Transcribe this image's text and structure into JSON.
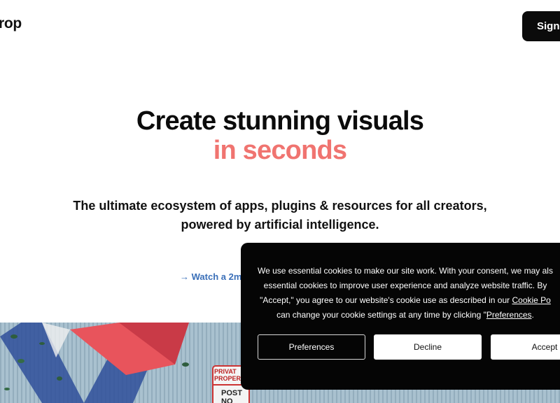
{
  "header": {
    "logo_text": "rop",
    "signup_label": "Sign-up"
  },
  "hero": {
    "title": "Create stunning visuals",
    "title_accent": "in seconds",
    "subtitle_line1": "The ultimate ecosystem of apps, plugins & resources for all creators,",
    "subtitle_line2": "powered by artificial intelligence.",
    "watch_link": "→ Watch a 2m",
    "accent_color": "#f07470",
    "link_color": "#3a6fb8"
  },
  "hero_image": {
    "sign_line1": "PRIVAT",
    "sign_line2": "PROPER",
    "sign_line3": "POST",
    "sign_line4": "NO"
  },
  "cookie_banner": {
    "line1": "We use essential cookies to make our site work. With your consent, we may als",
    "line2": "essential cookies to improve user experience and analyze website traffic. By",
    "line3_pre": "\"Accept,\" you agree to our website's cookie use as described in our ",
    "line3_link": "Cookie Po",
    "line4_pre": "can change your cookie settings at any time by clicking \"",
    "line4_link": "Preferences",
    "line4_post": ".",
    "preferences_label": "Preferences",
    "decline_label": "Decline",
    "accept_label": "Accept"
  }
}
